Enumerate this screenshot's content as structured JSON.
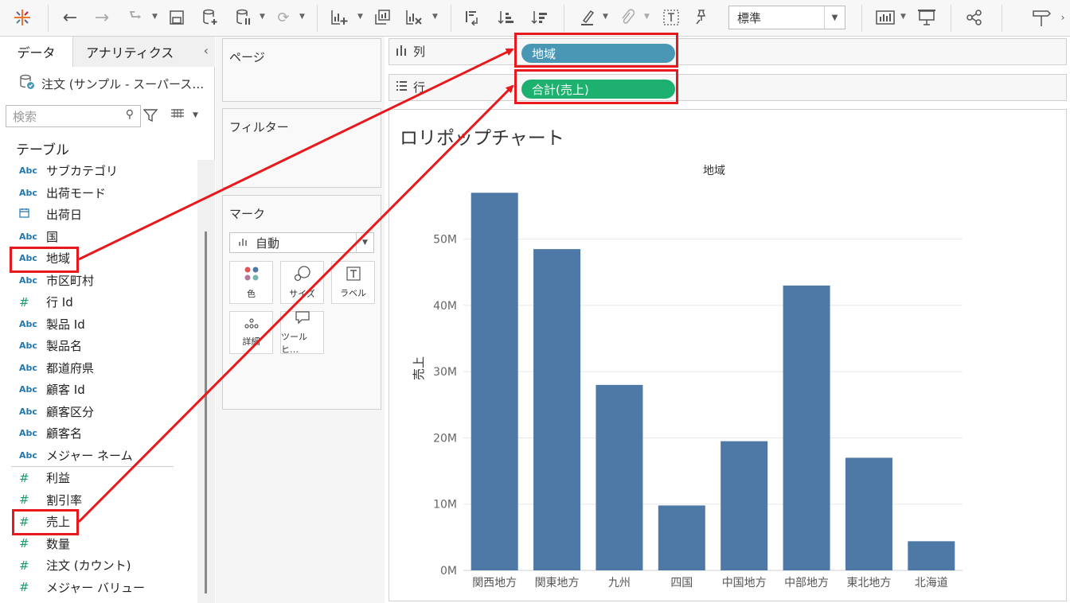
{
  "toolbar": {
    "fit_value": "標準"
  },
  "data_pane": {
    "tabs": [
      {
        "label": "データ"
      },
      {
        "label": "アナリティクス"
      }
    ],
    "datasource": "注文 (サンプル - スーパース…",
    "search_placeholder": "検索",
    "section_title": "テーブル",
    "dimensions": [
      {
        "type": "Abc",
        "label": "サブカテゴリ"
      },
      {
        "type": "Abc",
        "label": "出荷モード"
      },
      {
        "type": "date",
        "label": "出荷日"
      },
      {
        "type": "Abc",
        "label": "国"
      },
      {
        "type": "Abc",
        "label": "地域"
      },
      {
        "type": "Abc",
        "label": "市区町村"
      },
      {
        "type": "#",
        "label": "行 Id"
      },
      {
        "type": "Abc",
        "label": "製品 Id"
      },
      {
        "type": "Abc",
        "label": "製品名"
      },
      {
        "type": "Abc",
        "label": "都道府県"
      },
      {
        "type": "Abc",
        "label": "顧客 Id"
      },
      {
        "type": "Abc",
        "label": "顧客区分"
      },
      {
        "type": "Abc",
        "label": "顧客名"
      },
      {
        "type": "Abc",
        "label": "メジャー ネーム"
      }
    ],
    "measures": [
      {
        "type": "#",
        "label": "利益"
      },
      {
        "type": "#",
        "label": "割引率"
      },
      {
        "type": "#",
        "label": "売上"
      },
      {
        "type": "#",
        "label": "数量"
      },
      {
        "type": "#",
        "label": "注文 (カウント)"
      },
      {
        "type": "#",
        "label": "メジャー バリュー"
      }
    ]
  },
  "cards": {
    "pages_title": "ページ",
    "filters_title": "フィルター",
    "marks_title": "マーク",
    "mark_type": "自動",
    "mark_buttons": [
      {
        "icon": "color-icon",
        "label": "色"
      },
      {
        "icon": "size-icon",
        "label": "サイズ"
      },
      {
        "icon": "label-icon",
        "label": "ラベル"
      },
      {
        "icon": "detail-icon",
        "label": "詳細"
      },
      {
        "icon": "tooltip-icon",
        "label": "ツールヒ…"
      }
    ]
  },
  "shelves": {
    "columns_label": "列",
    "rows_label": "行",
    "columns_pill": "地域",
    "rows_pill": "合計(売上)"
  },
  "view": {
    "title": "ロリポップチャート",
    "column_header": "地域"
  },
  "chart_data": {
    "type": "bar",
    "categories": [
      "関西地方",
      "関東地方",
      "九州",
      "四国",
      "中国地方",
      "中部地方",
      "東北地方",
      "北海道"
    ],
    "values": [
      57,
      48.5,
      28,
      9.8,
      19.5,
      43,
      17,
      4.4
    ],
    "unit": "M",
    "ylabel": "売上",
    "ylim": [
      0,
      58
    ],
    "yticks": [
      "0M",
      "10M",
      "20M",
      "30M",
      "40M",
      "50M"
    ],
    "grid": true,
    "bar_color": "#4e79a7"
  },
  "colors": {
    "highlight": "#e8191c",
    "dimension_pill": "#4a97b5",
    "measure_pill": "#1db06f"
  }
}
